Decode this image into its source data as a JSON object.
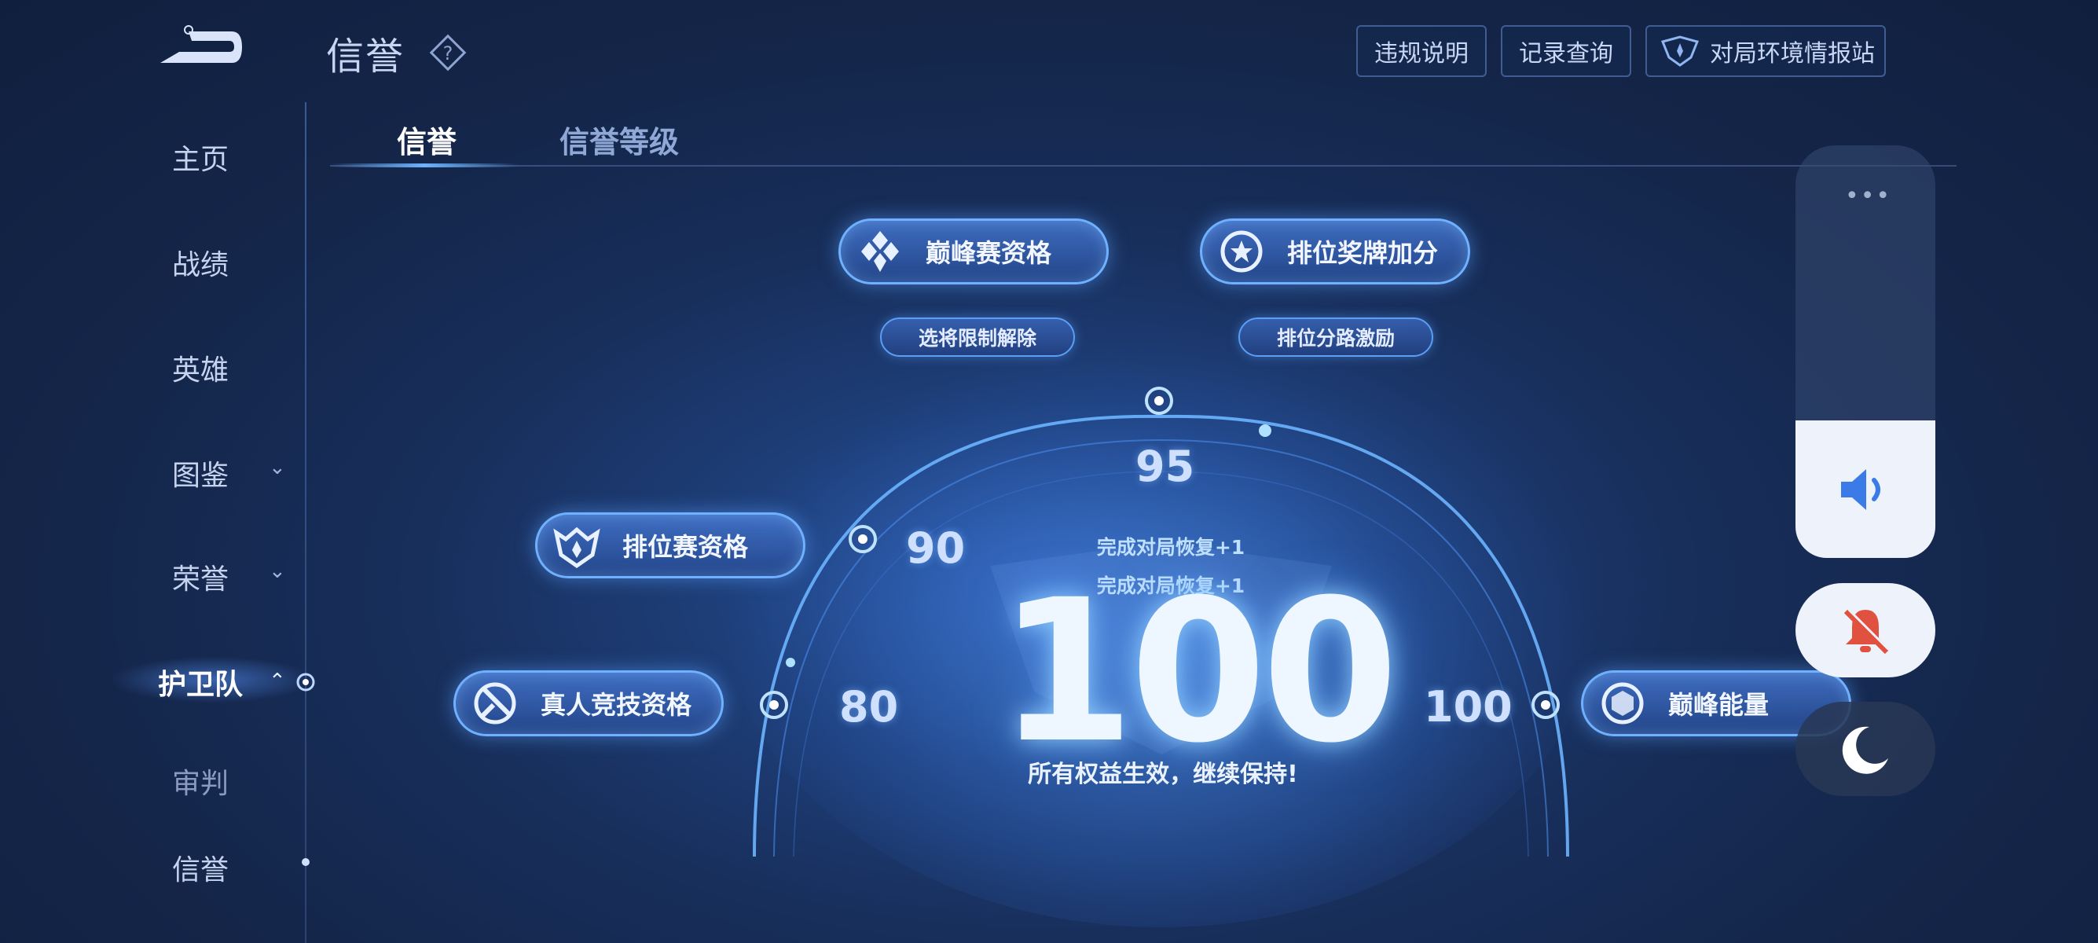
{
  "header": {
    "title": "信誉",
    "buttons": [
      "违规说明",
      "记录查询",
      "对局环境情报站"
    ]
  },
  "sidebar": {
    "items": [
      {
        "label": "主页"
      },
      {
        "label": "战绩"
      },
      {
        "label": "英雄"
      },
      {
        "label": "图鉴"
      },
      {
        "label": "荣誉"
      },
      {
        "label": "护卫队"
      },
      {
        "label": "审判"
      },
      {
        "label": "信誉"
      }
    ]
  },
  "tabs": [
    {
      "label": "信誉",
      "active": true
    },
    {
      "label": "信誉等级",
      "active": false
    }
  ],
  "benefits": {
    "peak_qualify": "巅峰赛资格",
    "rank_medal": "排位奖牌加分",
    "hero_unlock": "选将限制解除",
    "lane_bonus": "排位分路激励",
    "rank_qualify": "排位赛资格",
    "real_match": "真人竞技资格",
    "peak_energy": "巅峰能量"
  },
  "gauge": {
    "ticks": [
      "80",
      "90",
      "95",
      "100"
    ],
    "score": "100",
    "recover_lines": [
      "完成对局恢复+1",
      "完成对局恢复+1"
    ],
    "status": "所有权益生效，继续保持!"
  },
  "float_controls": {
    "menu_dots": "•••"
  },
  "colors": {
    "accent": "#6fb0ff",
    "mute_red": "#e0523f",
    "volume_blue": "#3b7be8"
  }
}
